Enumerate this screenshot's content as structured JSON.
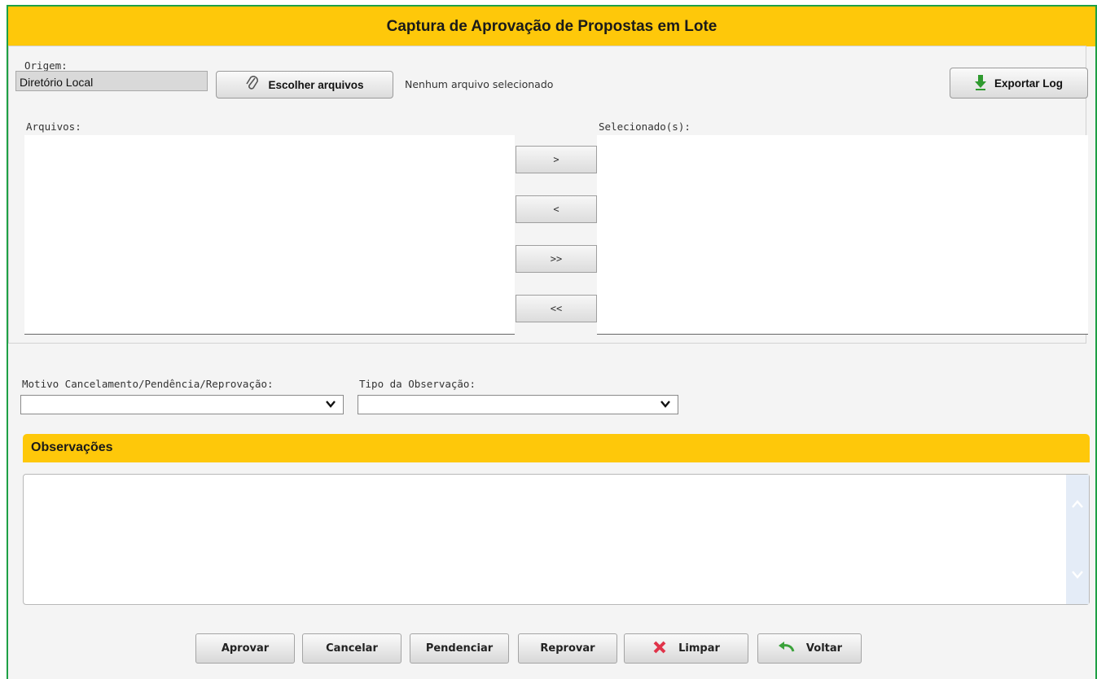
{
  "header": {
    "title": "Captura de Aprovação de Propostas em Lote"
  },
  "origem": {
    "label": "Origem:",
    "value": "Diretório Local"
  },
  "file_input": {
    "button_label": "Escolher arquivos",
    "status": "Nenhum arquivo selecionado",
    "icon": "paperclip-icon"
  },
  "export": {
    "label": "Exportar Log",
    "icon": "download-arrow-icon"
  },
  "lists": {
    "files_label": "Arquivos:",
    "selected_label": "Selecionado(s):"
  },
  "move_buttons": {
    "add_one": ">",
    "remove_one": "<",
    "add_all": ">>",
    "remove_all": "<<"
  },
  "motivo": {
    "label": "Motivo Cancelamento/Pendência/Reprovação:",
    "value": ""
  },
  "tipo": {
    "label": "Tipo da Observação:",
    "value": ""
  },
  "observacoes": {
    "title": "Observações",
    "value": ""
  },
  "actions": {
    "aprovar": "Aprovar",
    "cancelar": "Cancelar",
    "pendenciar": "Pendenciar",
    "reprovar": "Reprovar",
    "limpar": "Limpar",
    "voltar": "Voltar"
  },
  "colors": {
    "accent": "#fec80a",
    "frame_border": "#1ea045",
    "limpar_icon": "#e0344a",
    "voltar_icon": "#3aa23a",
    "export_icon": "#2f9a2f"
  }
}
